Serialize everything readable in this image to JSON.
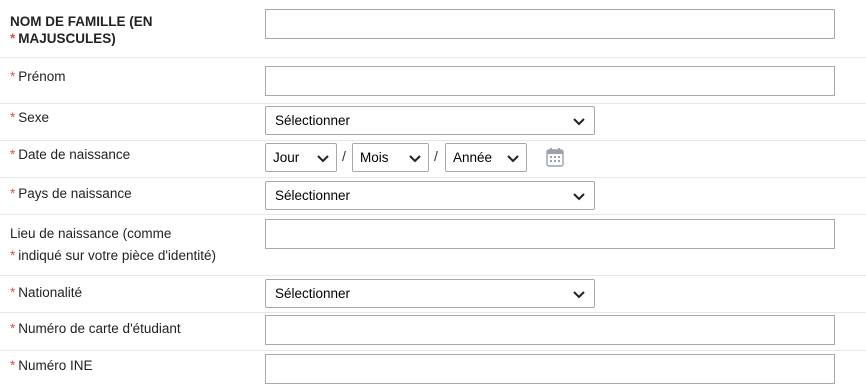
{
  "form": {
    "required_marker": "*",
    "fields": {
      "nom": {
        "label_line1": "NOM DE FAMILLE (EN",
        "label_line2": "MAJUSCULES)",
        "value": ""
      },
      "prenom": {
        "label": "Prénom",
        "value": ""
      },
      "sexe": {
        "label": "Sexe",
        "selected": "Sélectionner"
      },
      "date": {
        "label": "Date de naissance",
        "day": "Jour",
        "month": "Mois",
        "year": "Année",
        "separator": "/",
        "icon": "calendar-icon"
      },
      "pays": {
        "label": "Pays de naissance",
        "selected": "Sélectionner"
      },
      "lieu": {
        "label_line1": "Lieu de naissance (comme",
        "label_line2": "indiqué sur votre pièce d'identité)",
        "value": ""
      },
      "nationalite": {
        "label": "Nationalité",
        "selected": "Sélectionner"
      },
      "carte": {
        "label": "Numéro de carte d'étudiant",
        "value": ""
      },
      "ine": {
        "label": "Numéro INE",
        "value": ""
      }
    }
  },
  "colors": {
    "required": "#d9534f",
    "border": "#a9a9a9",
    "separator": "#e6e6e6"
  }
}
